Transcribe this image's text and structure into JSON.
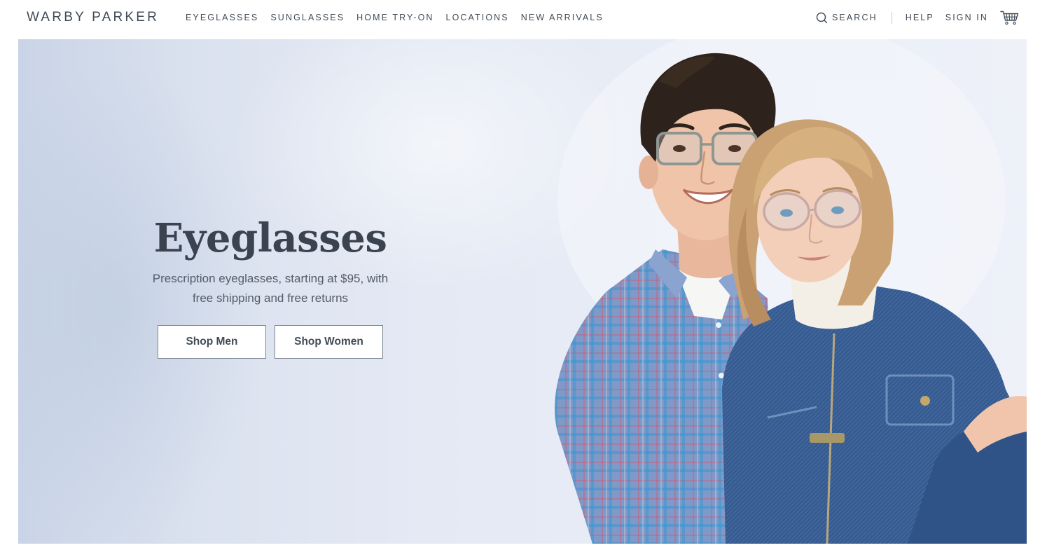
{
  "header": {
    "logo": "WARBY PARKER",
    "nav": [
      {
        "label": "EYEGLASSES"
      },
      {
        "label": "SUNGLASSES"
      },
      {
        "label": "HOME TRY-ON"
      },
      {
        "label": "LOCATIONS"
      },
      {
        "label": "NEW ARRIVALS"
      }
    ],
    "search_label": "SEARCH",
    "help_label": "HELP",
    "signin_label": "SIGN IN",
    "icons": {
      "search": "search-icon",
      "cart": "cart-icon"
    }
  },
  "hero": {
    "title": "Eyeglasses",
    "subtitle_line1": "Prescription eyeglasses, starting at $95, with",
    "subtitle_line2": "free shipping and free returns",
    "buttons": {
      "men": "Shop Men",
      "women": "Shop Women"
    }
  },
  "colors": {
    "text": "#414b56",
    "hero_bg": "#e4e9f4",
    "button_border": "#7d8690"
  }
}
